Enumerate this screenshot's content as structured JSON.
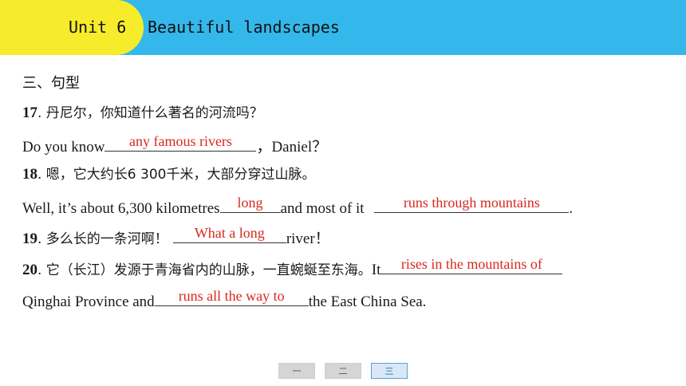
{
  "header": {
    "unit": "Unit 6",
    "title": "Beautiful landscapes"
  },
  "section_title": "三、句型",
  "items": [
    {
      "num": "17",
      "cn": ". 丹尼尔，你知道什么著名的河流吗？",
      "en_before": "Do you know",
      "answer": "any famous rivers",
      "en_after": "，Daniel？"
    },
    {
      "num": "18",
      "cn": ". 嗯，它大约长6 300千米，大部分穿过山脉。",
      "en_before": "Well,  it’s about 6,300 kilometres",
      "answer1": "long",
      "en_mid": "and most of it ",
      "answer2": "runs through mountains",
      "en_after": "."
    },
    {
      "num": "19",
      "cn": ". 多么长的一条河啊！",
      "answer": "What a long",
      "en_after": "river！"
    },
    {
      "num": "20",
      "cn": ". 它（长江）发源于青海省内的山脉，一直蜿蜒至东海。",
      "en_before": "It",
      "answer1": "rises in the mountains of",
      "en_line2_before": "Qinghai Province and",
      "answer2": "runs all the way to",
      "en_after": "the East China Sea."
    }
  ],
  "nav": [
    "一",
    "二",
    "三"
  ],
  "colors": {
    "header_blue": "#34b8ec",
    "tab_yellow": "#f6ec2b",
    "answer_red": "#d9281e"
  }
}
